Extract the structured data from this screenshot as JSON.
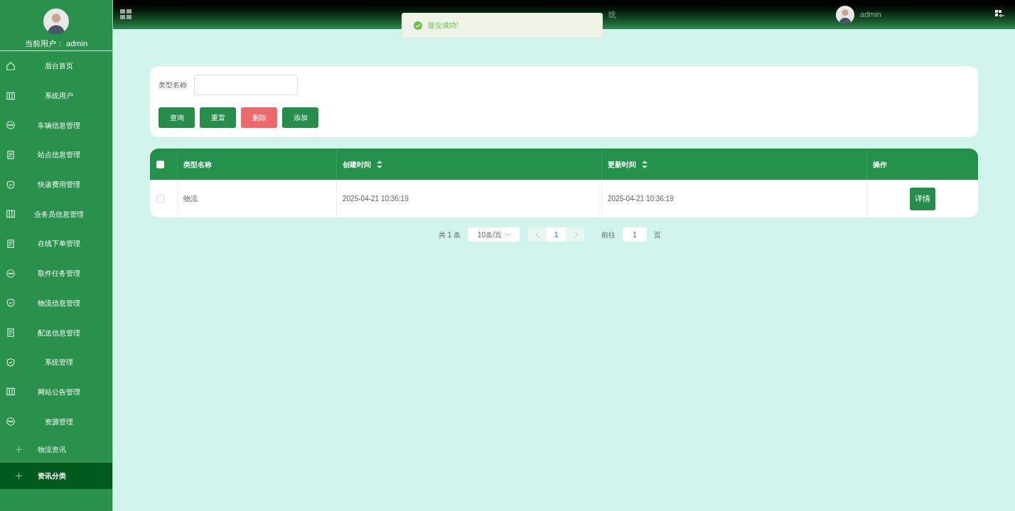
{
  "user": {
    "label": "当前用户：",
    "name": "admin"
  },
  "header": {
    "title_fragment": "统",
    "username": "admin"
  },
  "toast": {
    "message": "提交成功!"
  },
  "sidebar": {
    "items": [
      {
        "label": "后台首页",
        "kind": "home",
        "selected": false
      },
      {
        "label": "系统用户",
        "kind": "columns",
        "selected": false
      },
      {
        "label": "车辆信息管理",
        "kind": "chat",
        "selected": false
      },
      {
        "label": "站点信息管理",
        "kind": "document",
        "selected": false
      },
      {
        "label": "快递费用管理",
        "kind": "shield",
        "selected": false
      },
      {
        "label": "业务员信息管理",
        "kind": "columns",
        "selected": false
      },
      {
        "label": "在线下单管理",
        "kind": "document",
        "selected": false
      },
      {
        "label": "取件任务管理",
        "kind": "chat",
        "selected": false
      },
      {
        "label": "物流信息管理",
        "kind": "shield",
        "selected": false
      },
      {
        "label": "配送信息管理",
        "kind": "document",
        "selected": false
      },
      {
        "label": "系统管理",
        "kind": "shield",
        "selected": false
      },
      {
        "label": "网站公告管理",
        "kind": "columns",
        "selected": false
      },
      {
        "label": "资源管理",
        "kind": "chat",
        "selected": false,
        "children": [
          {
            "label": "物流资讯",
            "selected": false
          },
          {
            "label": "资讯分类",
            "selected": true
          }
        ]
      }
    ]
  },
  "search": {
    "label": "类型名称"
  },
  "buttons": [
    {
      "label": "查询",
      "kind": "primary"
    },
    {
      "label": "重置",
      "kind": "primary"
    },
    {
      "label": "删除",
      "kind": "danger"
    },
    {
      "label": "添加",
      "kind": "primary"
    }
  ],
  "table": {
    "all_checked": false,
    "columns": [
      {
        "label": "类型名称",
        "sortable": false
      },
      {
        "label": "创建时间",
        "sortable": true
      },
      {
        "label": "更新时间",
        "sortable": true
      },
      {
        "label": "操作",
        "sortable": false
      }
    ],
    "rows": [
      {
        "checked": false,
        "cells": [
          "物流",
          "2025-04-21 10:36:19",
          "2025-04-21 10:36:19"
        ],
        "action": "详情"
      }
    ]
  },
  "pagination": {
    "total": "共 1 条",
    "page_size": "10条/页",
    "pages": [
      {
        "label": "1",
        "selected": true
      }
    ],
    "goto_label": "前往",
    "goto_value": "1",
    "goto_suffix": "页"
  }
}
